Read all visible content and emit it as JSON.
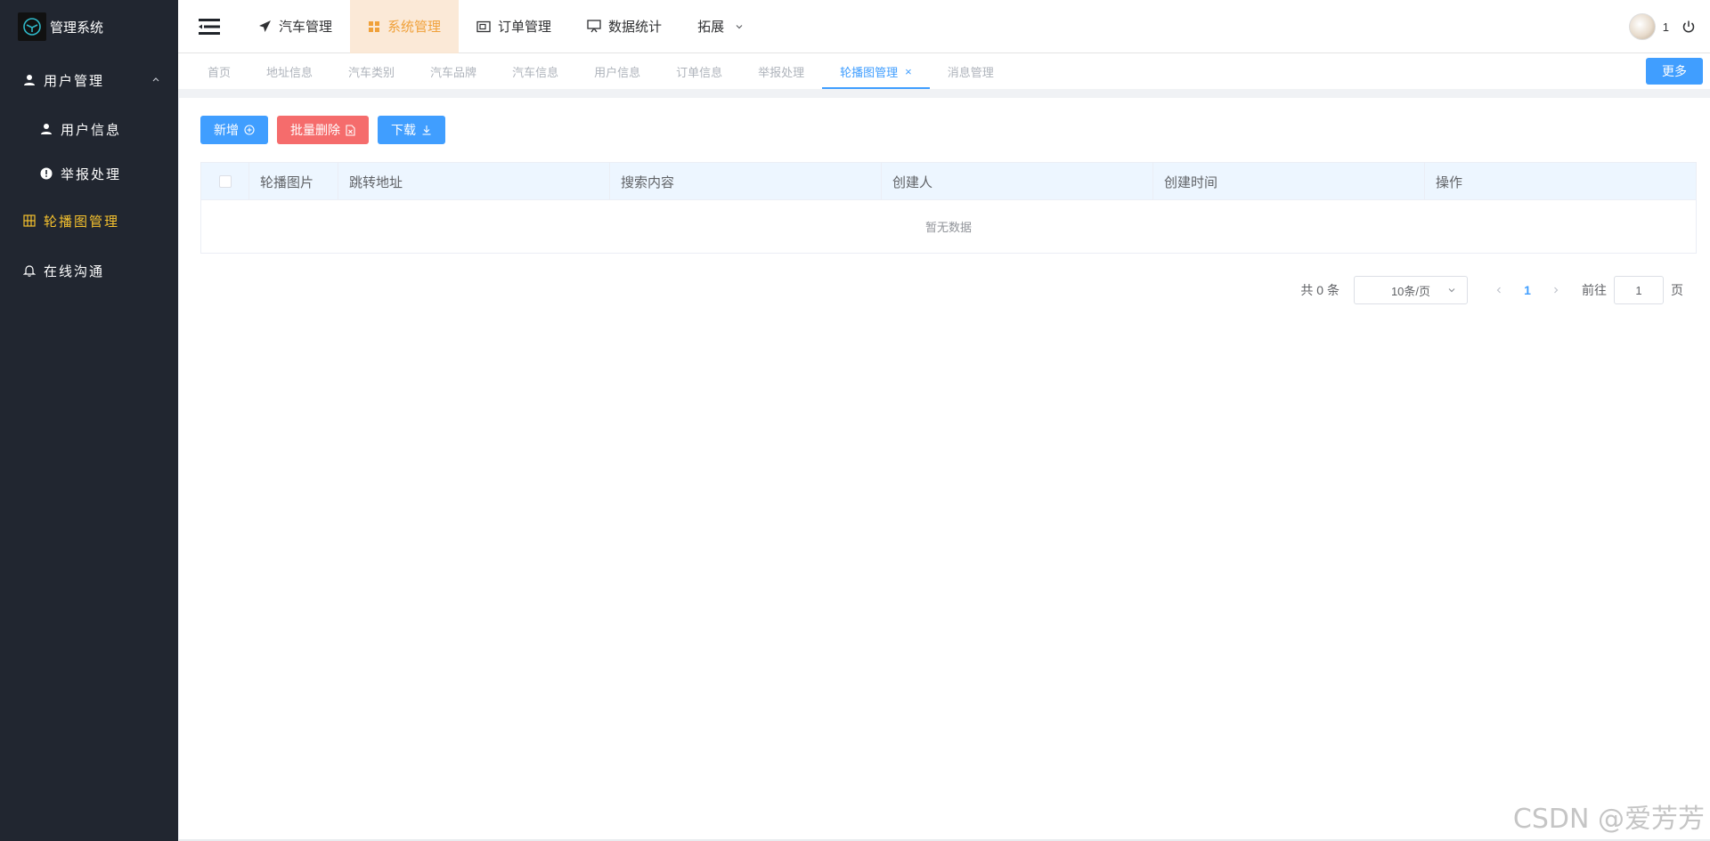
{
  "app": {
    "title": "管理系统"
  },
  "sidebar": {
    "items": [
      {
        "label": "用户管理",
        "icon": "user-icon",
        "expanded": true
      },
      {
        "label": "用户信息",
        "icon": "user-icon"
      },
      {
        "label": "举报处理",
        "icon": "warning-icon"
      },
      {
        "label": "轮播图管理",
        "icon": "grid-icon",
        "active": true
      },
      {
        "label": "在线沟通",
        "icon": "bell-icon"
      }
    ]
  },
  "topnav": {
    "items": [
      {
        "label": "汽车管理",
        "icon": "paper-plane-icon"
      },
      {
        "label": "系统管理",
        "icon": "apps-grid-icon",
        "active": true
      },
      {
        "label": "订单管理",
        "icon": "ticket-icon"
      },
      {
        "label": "数据统计",
        "icon": "presentation-icon"
      },
      {
        "label": "拓展",
        "icon": "chevron-down-icon"
      }
    ],
    "user": {
      "name": "1"
    }
  },
  "tabs": {
    "items": [
      "首页",
      "地址信息",
      "汽车类别",
      "汽车品牌",
      "汽车信息",
      "用户信息",
      "订单信息",
      "举报处理",
      "轮播图管理",
      "消息管理"
    ],
    "active_index": 8,
    "close_symbol": "×",
    "more_label": "更多"
  },
  "toolbar": {
    "add_label": "新增",
    "batch_delete_label": "批量删除",
    "download_label": "下载"
  },
  "table": {
    "columns": [
      "轮播图片",
      "跳转地址",
      "搜索内容",
      "创建人",
      "创建时间",
      "操作"
    ],
    "empty_text": "暂无数据"
  },
  "pagination": {
    "total_text": "共 0 条",
    "page_size": "10条/页",
    "current_page": "1",
    "goto_label": "前往",
    "goto_value": "1",
    "page_suffix": "页"
  },
  "watermark": "CSDN @爱芳芳",
  "colors": {
    "sidebar_bg": "#212630",
    "accent": "#409eff",
    "danger": "#f56c6c",
    "active_menu": "#f5c12e",
    "active_topnav_bg": "#fbe9d7",
    "active_topnav_text": "#f0a13a"
  }
}
